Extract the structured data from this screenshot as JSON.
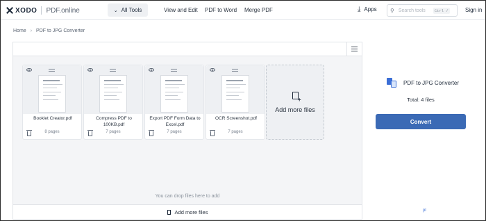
{
  "header": {
    "logo_text": "XODO",
    "logo_sub": "PDF.online",
    "all_tools": "All Tools",
    "nav": [
      "View and Edit",
      "PDF to Word",
      "Merge PDF"
    ],
    "apps": "Apps",
    "search_placeholder": "Search tools",
    "search_shortcut": "Ctrl /",
    "sign_in": "Sign in"
  },
  "breadcrumb": {
    "home": "Home",
    "current": "PDF to JPG Converter"
  },
  "files": [
    {
      "name": "Booklet Creator.pdf",
      "pages": "8 pages"
    },
    {
      "name": "Compress PDF to 100KB.pdf",
      "pages": "7 pages"
    },
    {
      "name": "Export PDF Form Data to Excel.pdf",
      "pages": "7 pages"
    },
    {
      "name": "OCR Screenshot.pdf",
      "pages": "7 pages"
    }
  ],
  "add_more_card": "Add more files",
  "drop_hint": "You can drop files here to add",
  "add_more_bottom": "Add more files",
  "tool": {
    "title": "PDF to JPG Converter",
    "total": "Total: 4 files",
    "convert": "Convert"
  },
  "corner_mark": "pl",
  "colors": {
    "accent": "#3b6ab5",
    "icon_blue": "#3b6ed6"
  }
}
